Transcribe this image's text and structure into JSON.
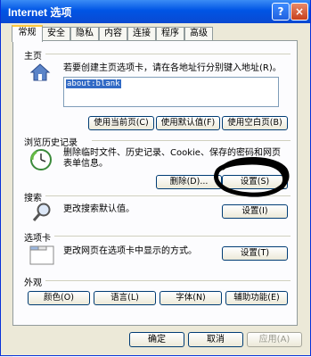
{
  "window": {
    "title": "Internet 选项",
    "help_glyph": "?",
    "close_glyph": "×"
  },
  "tabs": [
    "常规",
    "安全",
    "隐私",
    "内容",
    "连接",
    "程序",
    "高级"
  ],
  "home": {
    "label": "主页",
    "description": "若要创建主页选项卡，请在各地址行分别键入地址(R)。",
    "url": "about:blank",
    "buttons": [
      "使用当前页(C)",
      "使用默认值(F)",
      "使用空白页(B)"
    ]
  },
  "history": {
    "label": "浏览历史记录",
    "description_line1": "删除临时文件、历史记录、Cookie、保存的密码和网页",
    "description_line2": "表单信息。",
    "delete_button": "删除(D)...",
    "settings_button": "设置(S)"
  },
  "search": {
    "label": "搜索",
    "description": "更改搜索默认值。",
    "settings_button": "设置(I)"
  },
  "tabsection": {
    "label": "选项卡",
    "description": "更改网页在选项卡中显示的方式。",
    "settings_button": "设置(T)"
  },
  "appearance": {
    "label": "外观",
    "buttons": [
      "颜色(O)",
      "语言(L)",
      "字体(N)",
      "辅助功能(E)"
    ]
  },
  "footer": {
    "ok": "确定",
    "cancel": "取消",
    "apply": "应用(A)"
  },
  "colors": {
    "titlebar": "#0a49d1",
    "selection": "#316ac5",
    "annotation": "#000000"
  }
}
